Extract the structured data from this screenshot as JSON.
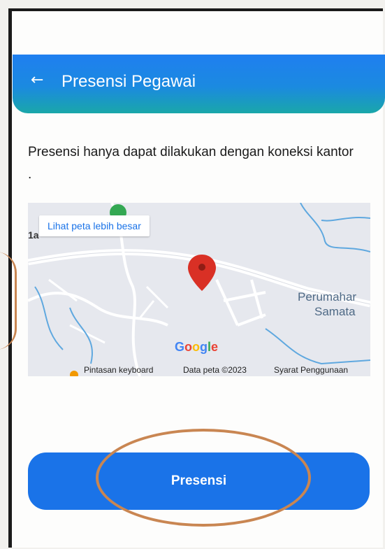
{
  "header": {
    "back_icon": "arrow-left-icon",
    "title": "Presensi Pegawai"
  },
  "notice": {
    "text": "Presensi hanya dapat dilakukan dengan koneksi kantor ."
  },
  "map": {
    "view_larger_label": "Lihat peta lebih besar",
    "cut_label": "1a",
    "place_labels": [
      "Perumahar",
      "Samata"
    ],
    "google_logo": "Google",
    "attribution": [
      "Pintasan keyboard",
      "Data peta ©2023",
      "Syarat Penggunaan"
    ],
    "marker_icon": "map-pin-icon"
  },
  "action": {
    "presensi_label": "Presensi"
  },
  "colors": {
    "primary": "#1a73e8",
    "appbar_top": "#1f7ff0",
    "appbar_bottom": "#1aa7a9",
    "marker": "#d93025",
    "annotation": "#c98652"
  }
}
